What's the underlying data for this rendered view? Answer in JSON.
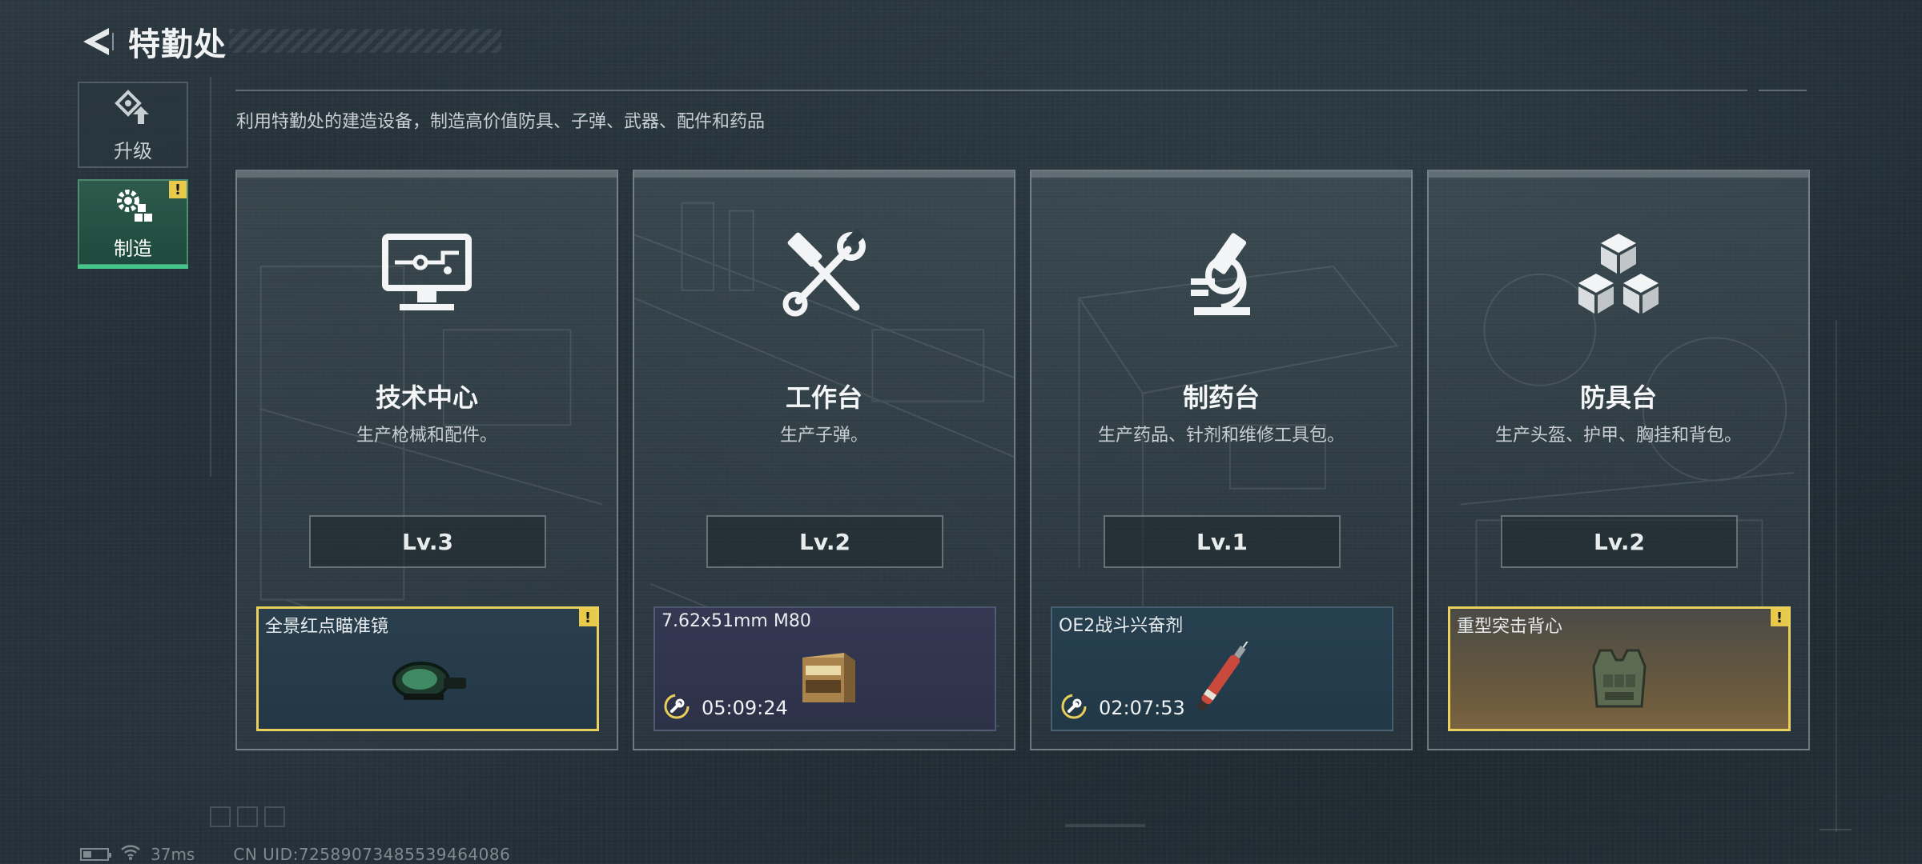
{
  "header": {
    "title": "特勤处"
  },
  "sidenav": {
    "items": [
      {
        "label": "升级",
        "icon": "upgrade-icon",
        "active": false,
        "alert": ""
      },
      {
        "label": "制造",
        "icon": "gear-cubes-icon",
        "active": true,
        "alert": "!"
      }
    ]
  },
  "subtitle": "利用特勤处的建造设备，制造高价值防具、子弹、武器、配件和药品",
  "cards": [
    {
      "icon": "monitor-network-icon",
      "title": "技术中心",
      "desc": "生产枪械和配件。",
      "level": "Lv.3",
      "slot": {
        "name": "全景红点瞄准镜",
        "timer": "",
        "alert": "!",
        "status": "ready",
        "item_icon": "red-dot-sight-icon"
      }
    },
    {
      "icon": "hammer-wrench-icon",
      "title": "工作台",
      "desc": "生产子弹。",
      "level": "Lv.2",
      "slot": {
        "name": "7.62x51mm M80",
        "timer": "05:09:24",
        "alert": "",
        "status": "crafting",
        "item_icon": "ammo-box-icon"
      }
    },
    {
      "icon": "microscope-icon",
      "title": "制药台",
      "desc": "生产药品、针剂和维修工具包。",
      "level": "Lv.1",
      "slot": {
        "name": "OE2战斗兴奋剂",
        "timer": "02:07:53",
        "alert": "",
        "status": "crafting",
        "item_icon": "injector-icon"
      }
    },
    {
      "icon": "cubes-icon",
      "title": "防具台",
      "desc": "生产头盔、护甲、胸挂和背包。",
      "level": "Lv.2",
      "slot": {
        "name": "重型突击背心",
        "timer": "",
        "alert": "!",
        "status": "ready",
        "item_icon": "vest-icon"
      }
    }
  ],
  "status": {
    "ping": "37ms",
    "uid": "CN UID:7258907348553946408​6"
  },
  "colors": {
    "accent_green": "#43c58a",
    "alert_yellow": "#e8c94a",
    "ready_border": "#e9cf5c"
  }
}
